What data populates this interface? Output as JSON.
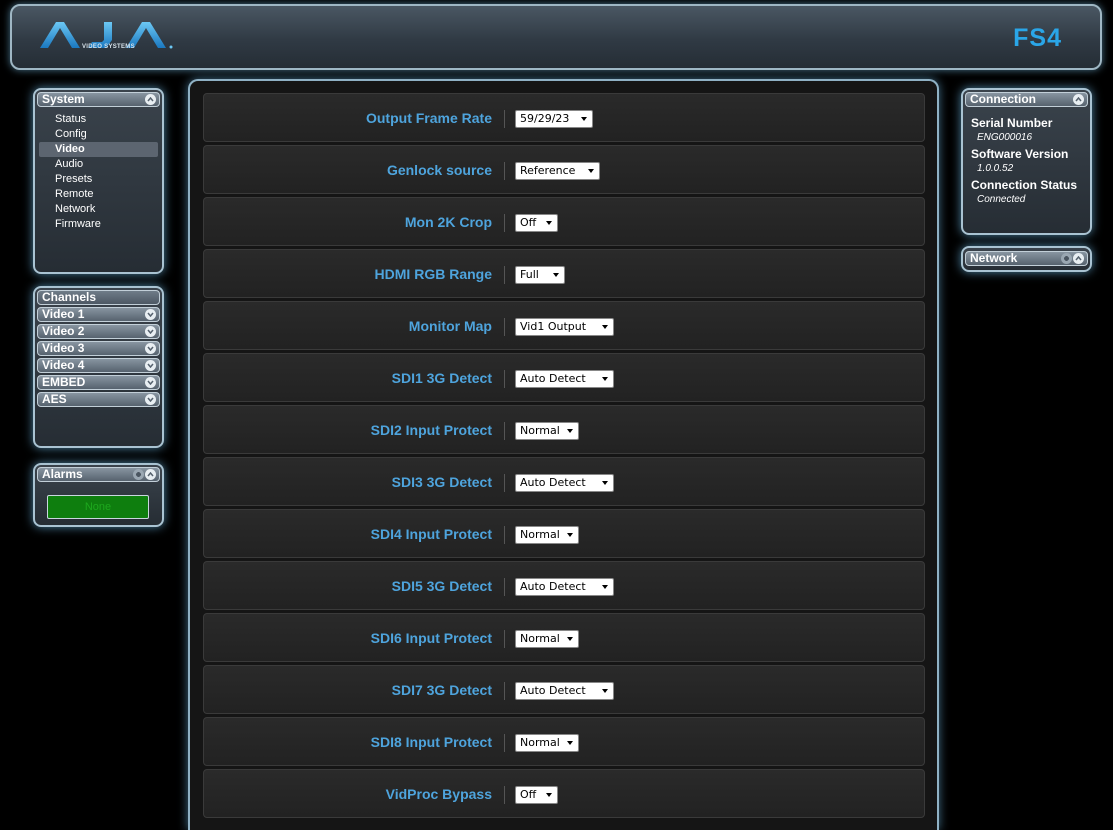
{
  "header": {
    "logo_text": "AJA",
    "logo_sub": "VIDEO SYSTEMS",
    "product": "FS4"
  },
  "sidebar": {
    "system": {
      "title": "System",
      "items": [
        {
          "label": "Status",
          "active": false
        },
        {
          "label": "Config",
          "active": false
        },
        {
          "label": "Video",
          "active": true
        },
        {
          "label": "Audio",
          "active": false
        },
        {
          "label": "Presets",
          "active": false
        },
        {
          "label": "Remote",
          "active": false
        },
        {
          "label": "Network",
          "active": false
        },
        {
          "label": "Firmware",
          "active": false
        }
      ]
    },
    "channels": {
      "title": "Channels",
      "items": [
        "Video 1",
        "Video 2",
        "Video 3",
        "Video 4",
        "EMBED",
        "AES"
      ]
    },
    "alarms": {
      "title": "Alarms",
      "status": "None"
    }
  },
  "main": {
    "rows": [
      {
        "label": "Output Frame Rate",
        "value": "59/29/23"
      },
      {
        "label": "Genlock source",
        "value": "Reference"
      },
      {
        "label": "Mon 2K Crop",
        "value": "Off"
      },
      {
        "label": "HDMI RGB Range",
        "value": "Full"
      },
      {
        "label": "Monitor Map",
        "value": "Vid1 Output"
      },
      {
        "label": "SDI1 3G Detect",
        "value": "Auto Detect"
      },
      {
        "label": "SDI2 Input Protect",
        "value": "Normal"
      },
      {
        "label": "SDI3 3G Detect",
        "value": "Auto Detect"
      },
      {
        "label": "SDI4 Input Protect",
        "value": "Normal"
      },
      {
        "label": "SDI5 3G Detect",
        "value": "Auto Detect"
      },
      {
        "label": "SDI6 Input Protect",
        "value": "Normal"
      },
      {
        "label": "SDI7 3G Detect",
        "value": "Auto Detect"
      },
      {
        "label": "SDI8 Input Protect",
        "value": "Normal"
      },
      {
        "label": "VidProc Bypass",
        "value": "Off"
      }
    ]
  },
  "right": {
    "connection": {
      "title": "Connection",
      "serial_label": "Serial Number",
      "serial_value": "ENG000016",
      "software_label": "Software Version",
      "software_value": "1.0.0.52",
      "status_label": "Connection Status",
      "status_value": "Connected"
    },
    "network": {
      "title": "Network"
    }
  },
  "colors": {
    "accent_blue": "#4ea4dd",
    "product_blue": "#2aa6e8",
    "alarm_green": "#0e7e0e"
  }
}
